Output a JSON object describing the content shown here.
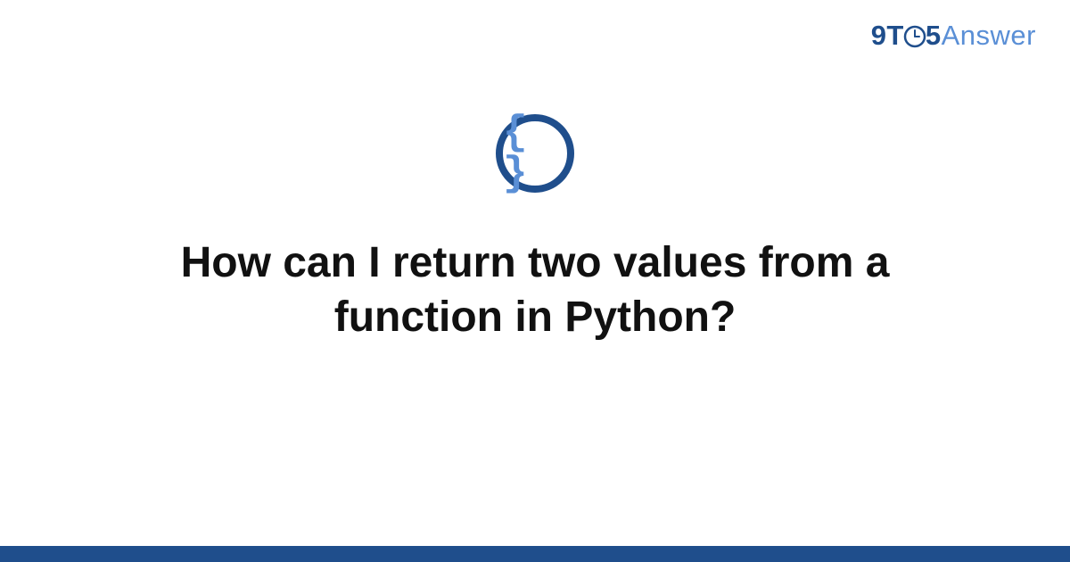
{
  "logo": {
    "part1": "9T",
    "part2": "5",
    "part3": "Answer",
    "clock_icon": "clock-icon"
  },
  "icon": {
    "name": "code-braces-icon",
    "text": "{ }"
  },
  "question": {
    "title": "How can I return two values from a function in Python?"
  },
  "colors": {
    "primary": "#1f4e8c",
    "accent": "#5a8fd6"
  }
}
